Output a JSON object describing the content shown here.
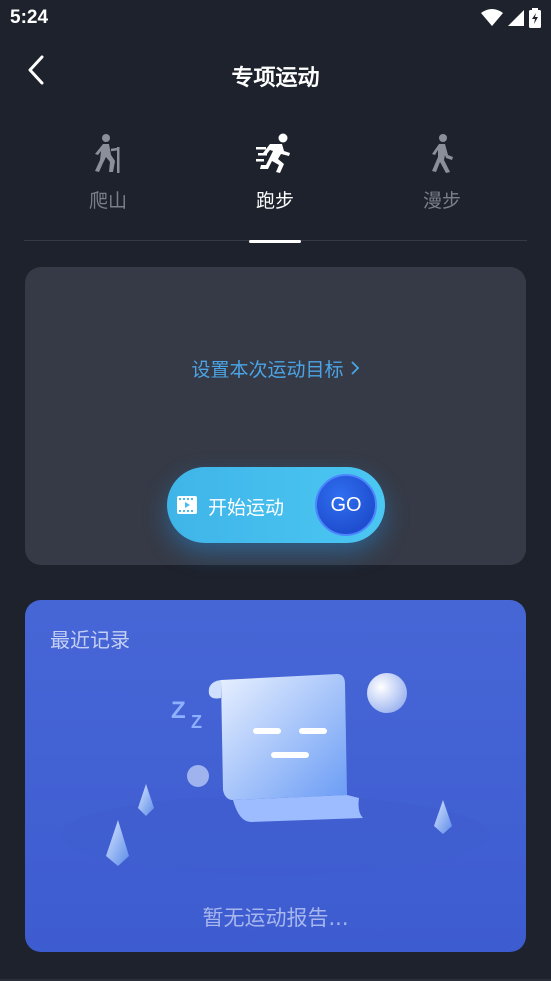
{
  "status_bar": {
    "time": "5:24",
    "icons": [
      "wifi-icon",
      "signal-icon",
      "battery-icon"
    ]
  },
  "header": {
    "back_icon": "back-arrow-icon",
    "title": "专项运动"
  },
  "tabs": [
    {
      "label": "爬山",
      "icon": "hiking-icon",
      "active": false
    },
    {
      "label": "跑步",
      "icon": "running-icon",
      "active": true
    },
    {
      "label": "漫步",
      "icon": "walking-icon",
      "active": false
    }
  ],
  "goal": {
    "link_label": "设置本次运动目标",
    "start_label": "开始运动",
    "go_label": "GO"
  },
  "records": {
    "title": "最近记录",
    "empty_text": "暂无运动报告..."
  },
  "colors": {
    "background": "#1e222c",
    "card": "#363a46",
    "accent_link": "#4aa4e6",
    "start_button": "#45bdee",
    "go_button": "#2558dc",
    "records_card": "#4463d4"
  }
}
